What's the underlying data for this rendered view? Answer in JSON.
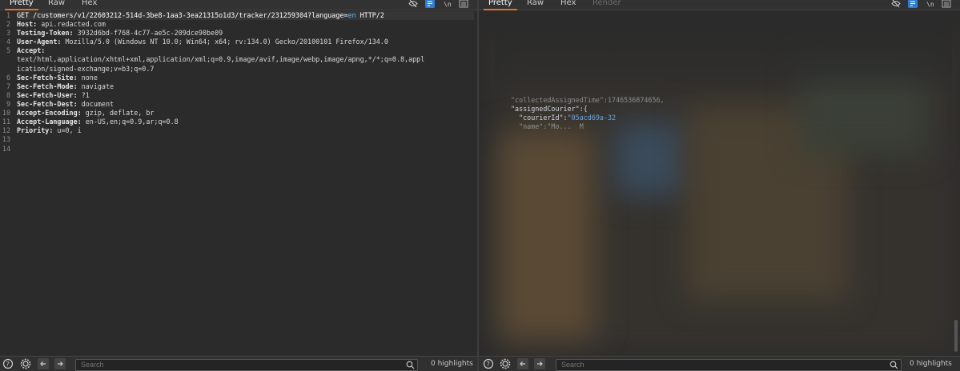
{
  "request_pane": {
    "tabs": [
      {
        "label": "Pretty",
        "active": true
      },
      {
        "label": "Raw",
        "active": false
      },
      {
        "label": "Hex",
        "active": false
      }
    ],
    "lines": [
      {
        "n": "1",
        "parts": [
          {
            "t": "GET /customers/v1/22603212-514d-3be8-1aa3-3ea21315o1d3/tracker/231259304?language=",
            "c": "kw"
          },
          {
            "t": "en",
            "c": "param-val"
          },
          {
            "t": " HTTP/2",
            "c": "kw"
          }
        ]
      },
      {
        "n": "2",
        "parts": [
          {
            "t": "Host: ",
            "c": "hdr-name"
          },
          {
            "t": "api.redacted.com",
            "c": ""
          }
        ]
      },
      {
        "n": "3",
        "parts": [
          {
            "t": "Testing-Token: ",
            "c": "hdr-name"
          },
          {
            "t": "3932d6bd-f768-4c77-ae5c-209dce90be09",
            "c": ""
          }
        ]
      },
      {
        "n": "4",
        "parts": [
          {
            "t": "User-Agent: ",
            "c": "hdr-name"
          },
          {
            "t": "Mozilla/5.0 (Windows NT 10.0; Win64; x64; rv:134.0) Gecko/20100101 Firefox/134.0",
            "c": ""
          }
        ]
      },
      {
        "n": "5",
        "parts": [
          {
            "t": "Accept:",
            "c": "hdr-name"
          }
        ]
      },
      {
        "n": "",
        "parts": [
          {
            "t": "text/html,application/xhtml+xml,application/xml;q=0.9,image/avif,image/webp,image/apng,*/*;q=0.8,appl",
            "c": ""
          }
        ]
      },
      {
        "n": "",
        "parts": [
          {
            "t": "ication/signed-exchange;v=b3;q=0.7",
            "c": ""
          }
        ]
      },
      {
        "n": "6",
        "parts": [
          {
            "t": "Sec-Fetch-Site: ",
            "c": "hdr-name"
          },
          {
            "t": "none",
            "c": ""
          }
        ]
      },
      {
        "n": "7",
        "parts": [
          {
            "t": "Sec-Fetch-Mode: ",
            "c": "hdr-name"
          },
          {
            "t": "navigate",
            "c": ""
          }
        ]
      },
      {
        "n": "8",
        "parts": [
          {
            "t": "Sec-Fetch-User: ",
            "c": "hdr-name"
          },
          {
            "t": "?1",
            "c": ""
          }
        ]
      },
      {
        "n": "9",
        "parts": [
          {
            "t": "Sec-Fetch-Dest: ",
            "c": "hdr-name"
          },
          {
            "t": "document",
            "c": ""
          }
        ]
      },
      {
        "n": "10",
        "parts": [
          {
            "t": "Accept-Encoding: ",
            "c": "hdr-name"
          },
          {
            "t": "gzip, deflate, br",
            "c": ""
          }
        ]
      },
      {
        "n": "11",
        "parts": [
          {
            "t": "Accept-Language: ",
            "c": "hdr-name"
          },
          {
            "t": "en-US,en;q=0.9,ar;q=0.8",
            "c": ""
          }
        ]
      },
      {
        "n": "12",
        "parts": [
          {
            "t": "Priority: ",
            "c": "hdr-name"
          },
          {
            "t": "u=0, i",
            "c": ""
          }
        ]
      },
      {
        "n": "13",
        "parts": []
      },
      {
        "n": "14",
        "parts": []
      }
    ],
    "search_placeholder": "Search",
    "highlights_label": "0 highlights"
  },
  "response_pane": {
    "tabs": [
      {
        "label": "Pretty",
        "active": true
      },
      {
        "label": "Raw",
        "active": false
      },
      {
        "label": "Hex",
        "active": false
      },
      {
        "label": "Render",
        "active": false,
        "dim": true
      }
    ],
    "lines": [
      {
        "parts": [
          {
            "t": "\"collectedAssignedTime\":1746536874656,",
            "c": "json-key"
          }
        ]
      },
      {
        "parts": [
          {
            "t": "\"assignedCourier\":{",
            "c": "json-key"
          }
        ]
      },
      {
        "parts": [
          {
            "t": "  \"courierId\":",
            "c": "json-key"
          },
          {
            "t": "\"05acd69a-32",
            "c": "json-str"
          }
        ]
      },
      {
        "parts": [
          {
            "t": "  \"name\":\"Mo...  M",
            "c": "json-key"
          }
        ]
      }
    ],
    "search_placeholder": "Search",
    "highlights_label": "0 highlights"
  },
  "icons": {
    "toolbar": [
      "eye-off-icon",
      "wrap-lines-icon",
      "newline-icon",
      "menu-icon"
    ],
    "status": [
      "help-icon",
      "settings-icon",
      "back-icon",
      "forward-icon",
      "search-icon"
    ]
  },
  "colors": {
    "accent": "#e8702a",
    "toggle_active": "#2f7fd6",
    "param": "#4fc1ff"
  }
}
